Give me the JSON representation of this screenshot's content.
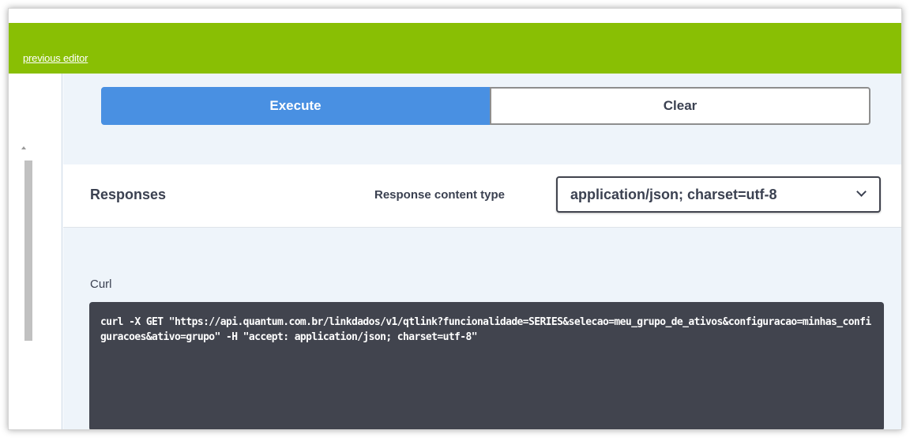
{
  "topbar": {
    "link_text": "previous editor",
    "color": "#89bf04"
  },
  "actions": {
    "execute_label": "Execute",
    "clear_label": "Clear",
    "execute_color": "#4990e2"
  },
  "responses": {
    "title": "Responses",
    "content_type_label": "Response content type",
    "content_type_value": "application/json; charset=utf-8"
  },
  "curl": {
    "label": "Curl",
    "command": "curl -X GET \"https://api.quantum.com.br/linkdados/v1/qtlink?funcionalidade=SERIES&selecao=meu_grupo_de_ativos&configuracao=minhas_configuracoes&ativo=grupo\" -H \"accept: application/json; charset=utf-8\"",
    "background": "#41444e"
  },
  "icons": {
    "select": "chevron-down-icon",
    "scroll": "scroll-up-arrow-icon"
  }
}
